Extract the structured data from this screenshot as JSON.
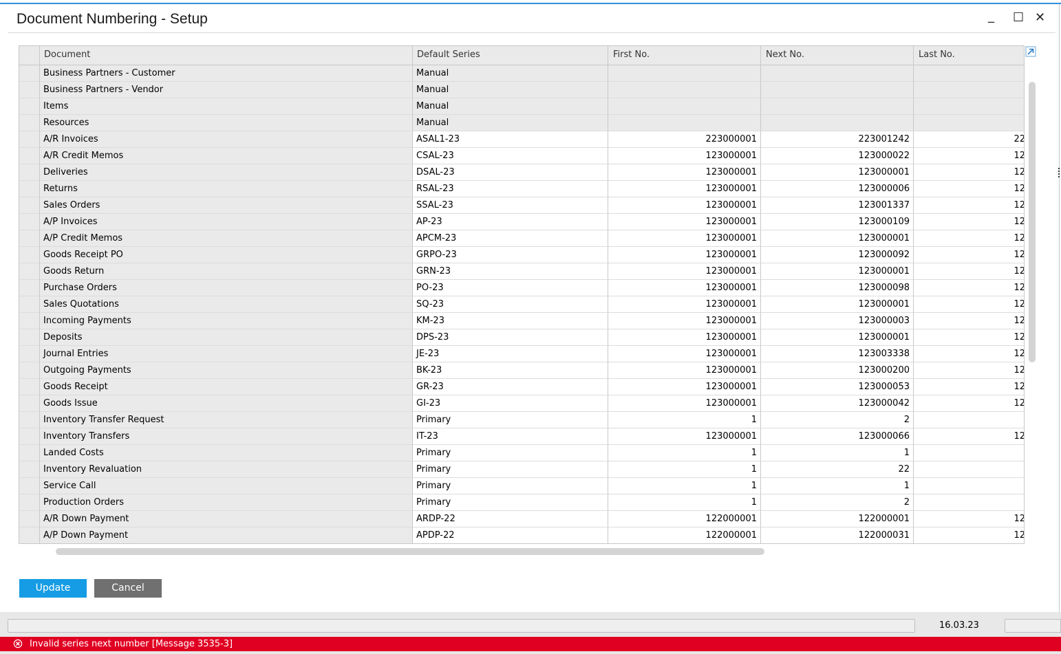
{
  "window": {
    "title": "Document Numbering - Setup",
    "controls": {
      "minimize": "_",
      "maximize": "☐",
      "close": "✕"
    }
  },
  "table": {
    "columns": [
      "Document",
      "Default Series",
      "First No.",
      "Next No.",
      "Last No."
    ],
    "rows": [
      {
        "document": "Business Partners - Customer",
        "series": "Manual",
        "first": "",
        "next": "",
        "last": "",
        "style": "grey"
      },
      {
        "document": "Business Partners - Vendor",
        "series": "Manual",
        "first": "",
        "next": "",
        "last": "",
        "style": "grey"
      },
      {
        "document": "Items",
        "series": "Manual",
        "first": "",
        "next": "",
        "last": "",
        "style": "grey"
      },
      {
        "document": "Resources",
        "series": "Manual",
        "first": "",
        "next": "",
        "last": "",
        "style": "grey"
      },
      {
        "document": "A/R Invoices",
        "series": "ASAL1-23",
        "first": "223000001",
        "next": "223001242",
        "last": "22",
        "style": "white"
      },
      {
        "document": "A/R Credit Memos",
        "series": "CSAL-23",
        "first": "123000001",
        "next": "123000022",
        "last": "12",
        "style": "white"
      },
      {
        "document": "Deliveries",
        "series": "DSAL-23",
        "first": "123000001",
        "next": "123000001",
        "last": "12",
        "style": "white"
      },
      {
        "document": "Returns",
        "series": "RSAL-23",
        "first": "123000001",
        "next": "123000006",
        "last": "12",
        "style": "white"
      },
      {
        "document": "Sales Orders",
        "series": "SSAL-23",
        "first": "123000001",
        "next": "123001337",
        "last": "12",
        "style": "white"
      },
      {
        "document": "A/P Invoices",
        "series": "AP-23",
        "first": "123000001",
        "next": "123000109",
        "last": "12",
        "style": "white"
      },
      {
        "document": "A/P Credit Memos",
        "series": "APCM-23",
        "first": "123000001",
        "next": "123000001",
        "last": "12",
        "style": "white"
      },
      {
        "document": "Goods Receipt PO",
        "series": "GRPO-23",
        "first": "123000001",
        "next": "123000092",
        "last": "12",
        "style": "white"
      },
      {
        "document": "Goods Return",
        "series": "GRN-23",
        "first": "123000001",
        "next": "123000001",
        "last": "12",
        "style": "white"
      },
      {
        "document": "Purchase Orders",
        "series": "PO-23",
        "first": "123000001",
        "next": "123000098",
        "last": "12",
        "style": "white"
      },
      {
        "document": "Sales Quotations",
        "series": "SQ-23",
        "first": "123000001",
        "next": "123000001",
        "last": "12",
        "style": "white"
      },
      {
        "document": "Incoming Payments",
        "series": "KM-23",
        "first": "123000001",
        "next": "123000003",
        "last": "12",
        "style": "white"
      },
      {
        "document": "Deposits",
        "series": "DPS-23",
        "first": "123000001",
        "next": "123000001",
        "last": "12",
        "style": "white"
      },
      {
        "document": "Journal Entries",
        "series": "JE-23",
        "first": "123000001",
        "next": "123003338",
        "last": "12",
        "style": "white"
      },
      {
        "document": "Outgoing Payments",
        "series": "BK-23",
        "first": "123000001",
        "next": "123000200",
        "last": "12",
        "style": "white"
      },
      {
        "document": "Goods Receipt",
        "series": "GR-23",
        "first": "123000001",
        "next": "123000053",
        "last": "12",
        "style": "white"
      },
      {
        "document": "Goods Issue",
        "series": "GI-23",
        "first": "123000001",
        "next": "123000042",
        "last": "12",
        "style": "white"
      },
      {
        "document": "Inventory Transfer Request",
        "series": "Primary",
        "first": "1",
        "next": "2",
        "last": "",
        "style": "white"
      },
      {
        "document": "Inventory Transfers",
        "series": "IT-23",
        "first": "123000001",
        "next": "123000066",
        "last": "12",
        "style": "white"
      },
      {
        "document": "Landed Costs",
        "series": "Primary",
        "first": "1",
        "next": "1",
        "last": "",
        "style": "white"
      },
      {
        "document": "Inventory Revaluation",
        "series": "Primary",
        "first": "1",
        "next": "22",
        "last": "",
        "style": "white"
      },
      {
        "document": "Service Call",
        "series": "Primary",
        "first": "1",
        "next": "1",
        "last": "",
        "style": "white"
      },
      {
        "document": "Production Orders",
        "series": "Primary",
        "first": "1",
        "next": "2",
        "last": "",
        "style": "white"
      },
      {
        "document": "A/R Down Payment",
        "series": "ARDP-22",
        "first": "122000001",
        "next": "122000001",
        "last": "12",
        "style": "white"
      },
      {
        "document": "A/P Down Payment",
        "series": "APDP-22",
        "first": "122000001",
        "next": "122000031",
        "last": "12",
        "style": "white"
      }
    ]
  },
  "buttons": {
    "update": "Update",
    "cancel": "Cancel"
  },
  "status": {
    "date": "16.03.23",
    "error_message": "Invalid series next number  [Message 3535-3]"
  },
  "icons": {
    "expand": "expand-arrow-icon",
    "error": "error-circle-icon"
  },
  "colors": {
    "accent": "#159ce4",
    "error": "#e00022",
    "cancel": "#707070"
  }
}
